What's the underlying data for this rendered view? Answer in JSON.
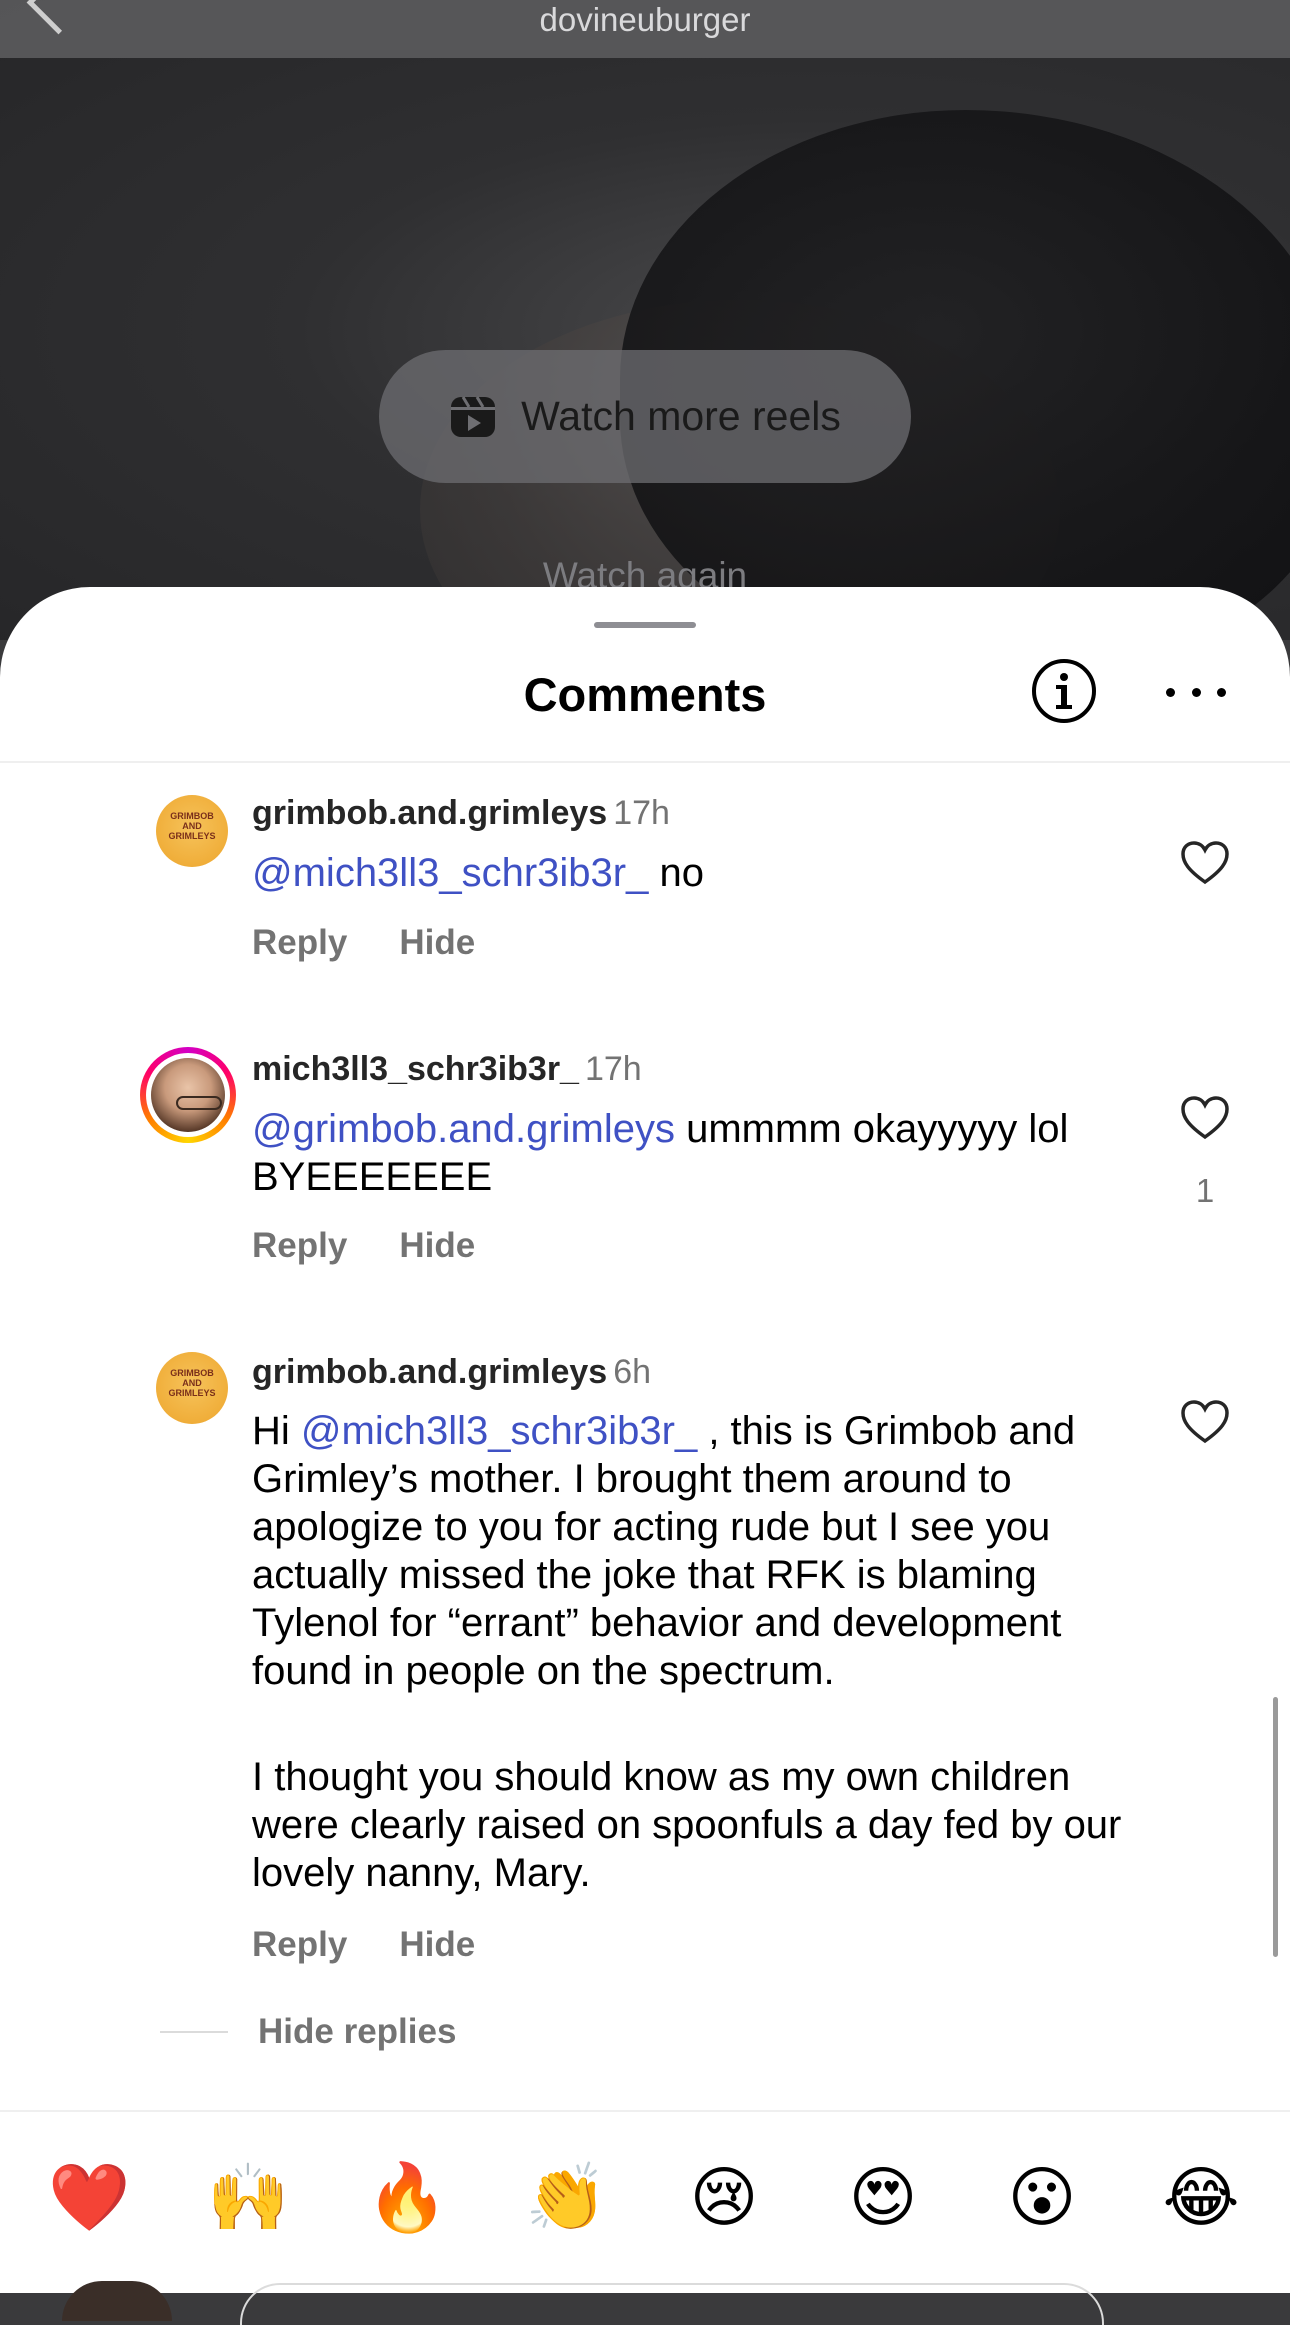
{
  "top": {
    "username": "dovineuburger",
    "watch_more_label": "Watch more reels",
    "watch_again_label": "Watch again"
  },
  "sheet": {
    "title": "Comments"
  },
  "comments": [
    {
      "username": "grimbob.and.grimleys",
      "time": "17h",
      "mention": "@mich3ll3_schr3ib3r_",
      "text": " no",
      "reply": "Reply",
      "hide": "Hide",
      "avatar_text": "GRIMBOB AND GRIMLEYS"
    },
    {
      "username": "mich3ll3_schr3ib3r_",
      "time": "17h",
      "mention": "@grimbob.and.grimleys",
      "text": " ummmm okayyyyy lol BYEEEEEEE",
      "reply": "Reply",
      "hide": "Hide",
      "likes": "1"
    },
    {
      "username": "grimbob.and.grimleys",
      "time": "6h",
      "prefix": "Hi ",
      "mention": "@mich3ll3_schr3ib3r_",
      "text": " , this is Grimbob and Grimley’s mother. I brought them around to apologize to you for acting rude but I see you actually missed the joke that RFK is blaming Tylenol for “errant” behavior and development found in people on the spectrum.",
      "text2": "I thought you should know as my own children were clearly raised on spoonfuls a day fed by our lovely nanny, Mary.",
      "reply": "Reply",
      "hide": "Hide",
      "avatar_text": "GRIMBOB AND GRIMLEYS"
    }
  ],
  "hide_replies_label": "Hide replies",
  "emoji_bar": [
    "❤️",
    "🙌",
    "🔥",
    "👏",
    "😢",
    "😍",
    "😮",
    "😂"
  ],
  "colors": {
    "mention": "#3f51c4",
    "meta": "#737373",
    "heart": "#262626"
  }
}
